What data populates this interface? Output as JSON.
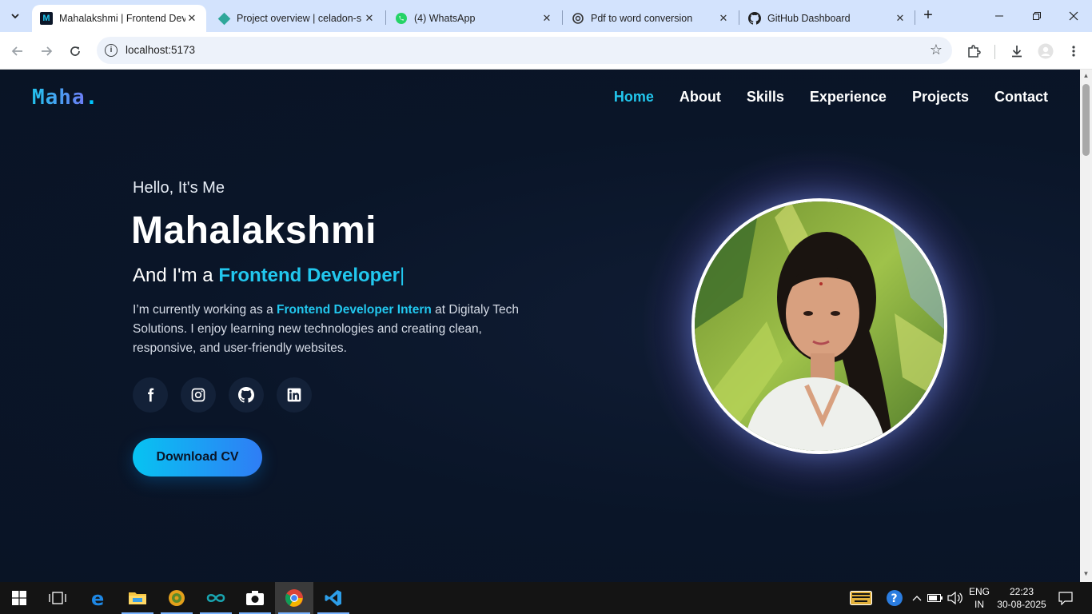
{
  "browser": {
    "tabs": [
      {
        "title": "Mahalakshmi | Frontend Developer",
        "favicon": "m-logo-icon",
        "active": true
      },
      {
        "title": "Project overview | celadon-s",
        "favicon": "diamond-icon",
        "active": false
      },
      {
        "title": "(4) WhatsApp",
        "favicon": "whatsapp-icon",
        "active": false
      },
      {
        "title": "Pdf to word conversion",
        "favicon": "openai-icon",
        "active": false
      },
      {
        "title": "GitHub Dashboard",
        "favicon": "github-icon",
        "active": false
      }
    ],
    "url": "localhost:5173"
  },
  "site": {
    "logo": {
      "name": "Maha",
      "dot": "."
    },
    "nav": [
      "Home",
      "About",
      "Skills",
      "Experience",
      "Projects",
      "Contact"
    ],
    "active_nav": "Home",
    "hero": {
      "greeting": "Hello, It's Me",
      "name": "Mahalakshmi",
      "role_prefix": "And I'm a",
      "role": "Frontend Developer",
      "cursor": "|",
      "desc_before": "I’m currently working as a",
      "desc_highlight": "Frontend Developer Intern",
      "desc_after": "at Digitaly Tech Solutions. I enjoy learning new technologies and creating clean, responsive, and user-friendly websites.",
      "cta": "Download CV",
      "socials": [
        "facebook-icon",
        "instagram-icon",
        "github-icon",
        "linkedin-icon"
      ]
    },
    "colors": {
      "accent": "#22c7ee",
      "background": "#0b1628",
      "button_gradient": [
        "#07c3f2",
        "#2f7df5"
      ]
    }
  },
  "taskbar": {
    "language": "ENG",
    "region": "IN",
    "time": "22:23",
    "date": "30-08-2025"
  }
}
